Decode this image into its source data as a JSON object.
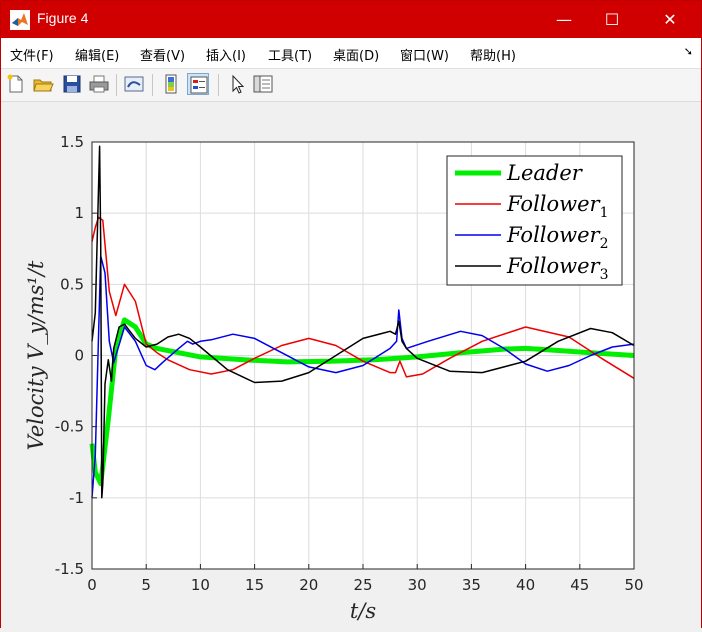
{
  "window": {
    "title": "Figure 4",
    "controls": {
      "minimize": "—",
      "maximize": "☐",
      "close": "✕"
    }
  },
  "menu": {
    "items": [
      "文件(F)",
      "编辑(E)",
      "查看(V)",
      "插入(I)",
      "工具(T)",
      "桌面(D)",
      "窗口(W)",
      "帮助(H)"
    ]
  },
  "toolbar": {
    "icons": [
      "new-figure-icon",
      "open-file-icon",
      "save-icon",
      "print-icon",
      "link-plot-icon",
      "insert-colorbar-icon",
      "insert-legend-icon",
      "pointer-icon",
      "property-inspector-icon"
    ]
  },
  "chart_data": {
    "type": "line",
    "xlabel": "t/s",
    "ylabel": "Velocity V_y/ms¹/t",
    "xlim": [
      0,
      50
    ],
    "ylim": [
      -1.5,
      1.5
    ],
    "xticks": [
      "0",
      "5",
      "10",
      "15",
      "20",
      "25",
      "30",
      "35",
      "40",
      "45",
      "50"
    ],
    "yticks": [
      "1.5",
      "1",
      "0.5",
      "0",
      "-0.5",
      "-1",
      "-1.5"
    ],
    "grid": true,
    "legend_position": "top-right",
    "series": [
      {
        "name": "Leader",
        "color": "#00ee00",
        "x": [
          0,
          0.3,
          0.8,
          1.5,
          2.2,
          3,
          4,
          5,
          6,
          8,
          10,
          14,
          18,
          22,
          26,
          30,
          34,
          38,
          40,
          42,
          46,
          50
        ],
        "y": [
          -0.62,
          -0.82,
          -0.9,
          -0.45,
          0.05,
          0.25,
          0.2,
          0.08,
          0.05,
          0.02,
          -0.01,
          -0.03,
          -0.045,
          -0.04,
          -0.03,
          -0.01,
          0.02,
          0.045,
          0.05,
          0.04,
          0.02,
          0.0
        ]
      },
      {
        "name": "Follower1",
        "color": "#ee0000",
        "x": [
          0,
          0.3,
          0.6,
          1.0,
          1.6,
          2.2,
          3.0,
          4.0,
          5.0,
          6.0,
          7.0,
          9.0,
          11.0,
          13.0,
          15.0,
          17.5,
          20.0,
          22.5,
          25.0,
          27.5,
          28.0,
          28.4,
          29.0,
          30.5,
          33.0,
          36.0,
          40.0,
          44.0,
          47.0,
          50.0
        ],
        "y": [
          0.8,
          0.9,
          0.97,
          0.95,
          0.45,
          0.28,
          0.5,
          0.38,
          0.08,
          0.02,
          -0.03,
          -0.1,
          -0.13,
          -0.1,
          -0.02,
          0.07,
          0.12,
          0.07,
          -0.04,
          -0.12,
          -0.12,
          -0.04,
          -0.15,
          -0.13,
          -0.02,
          0.1,
          0.2,
          0.13,
          -0.02,
          -0.16
        ]
      },
      {
        "name": "Follower2",
        "color": "#0000ee",
        "x": [
          0,
          0.3,
          0.8,
          1.2,
          1.6,
          2.0,
          3.0,
          4.0,
          5.0,
          5.8,
          6.5,
          8.0,
          8.8,
          9.3,
          10.0,
          11.0,
          13.0,
          15.0,
          17.5,
          20.0,
          22.5,
          25.0,
          27.5,
          28.1,
          28.3,
          28.6,
          29.0,
          31.0,
          34.0,
          36.0,
          38.0,
          40.0,
          42.0,
          44.0,
          46.0,
          48.0,
          50.0
        ],
        "y": [
          -1.0,
          -0.7,
          0.7,
          0.58,
          0.1,
          -0.05,
          0.2,
          0.1,
          -0.07,
          -0.1,
          -0.05,
          0.05,
          0.1,
          0.08,
          0.1,
          0.11,
          0.15,
          0.12,
          0.02,
          -0.08,
          -0.12,
          -0.07,
          0.05,
          0.1,
          0.32,
          0.12,
          0.05,
          0.1,
          0.17,
          0.14,
          0.05,
          -0.06,
          -0.11,
          -0.07,
          0.0,
          0.06,
          0.08
        ]
      },
      {
        "name": "Follower3",
        "color": "#000000",
        "x": [
          0,
          0.3,
          0.7,
          0.8,
          0.9,
          1.0,
          1.2,
          1.5,
          1.8,
          2.0,
          2.5,
          3.0,
          4.0,
          5.0,
          6.0,
          7.0,
          8.0,
          9.0,
          10.0,
          12.5,
          15.0,
          17.5,
          20.0,
          22.5,
          25.0,
          27.5,
          28.0,
          28.3,
          28.6,
          29.0,
          30.0,
          33.0,
          36.0,
          40.0,
          43.0,
          46.0,
          48.0,
          50.0
        ],
        "y": [
          0.1,
          0.3,
          1.47,
          0.8,
          -1.0,
          -0.9,
          -0.2,
          -0.03,
          -0.18,
          0.05,
          0.2,
          0.22,
          0.12,
          0.06,
          0.08,
          0.13,
          0.15,
          0.12,
          0.06,
          -0.1,
          -0.19,
          -0.18,
          -0.12,
          0.0,
          0.12,
          0.17,
          0.15,
          0.24,
          0.1,
          0.05,
          -0.02,
          -0.11,
          -0.12,
          -0.04,
          0.1,
          0.19,
          0.16,
          0.07
        ]
      }
    ]
  }
}
